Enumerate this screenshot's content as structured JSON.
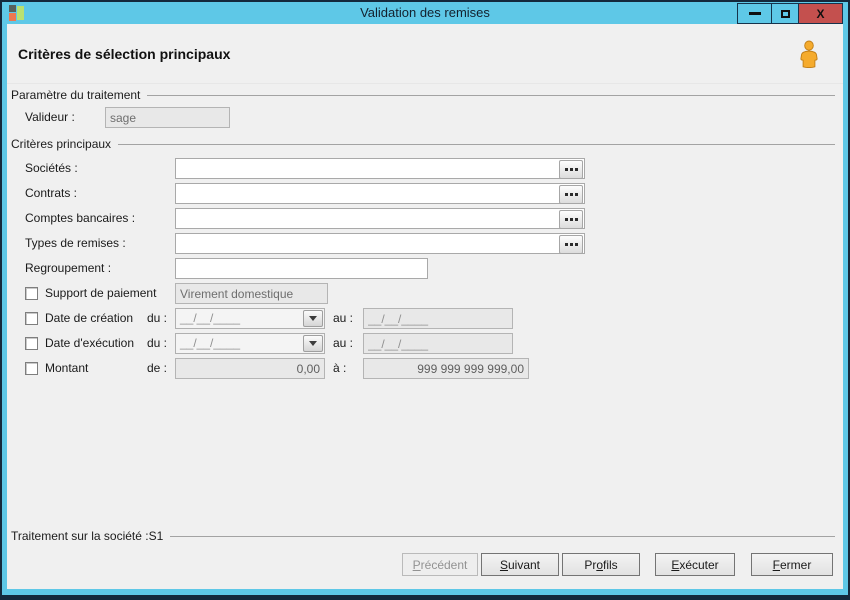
{
  "colors": {
    "titlebar": "#5ec8e7",
    "close_button": "#c4504e",
    "content_bg": "#f0f0f0",
    "user_icon_orange": "#f2a532"
  },
  "window": {
    "title": "Validation des remises",
    "controls": {
      "close_glyph": "X"
    }
  },
  "header": {
    "title": "Critères de sélection principaux"
  },
  "treatment_group": {
    "label": "Paramètre du traitement",
    "validator": {
      "label": "Valideur :",
      "value": "sage"
    }
  },
  "criteria_group": {
    "label": "Critères principaux",
    "lookup_rows": [
      {
        "label": "Sociétés :",
        "value": ""
      },
      {
        "label": "Contrats :",
        "value": ""
      },
      {
        "label": "Comptes bancaires :",
        "value": ""
      },
      {
        "label": "Types de remises :",
        "value": ""
      }
    ],
    "regroupement": {
      "label": "Regroupement :",
      "value": ""
    },
    "support": {
      "label": "Support de paiement",
      "checked": false,
      "value": "Virement domestique"
    },
    "date_creation": {
      "label": "Date de création",
      "checked": false,
      "from_label": "du :",
      "from_value": "__/__/____",
      "to_label": "au :",
      "to_value": "__/__/____"
    },
    "date_execution": {
      "label": "Date d'exécution",
      "checked": false,
      "from_label": "du :",
      "from_value": "__/__/____",
      "to_label": "au :",
      "to_value": "__/__/____"
    },
    "montant": {
      "label": "Montant",
      "checked": false,
      "from_label": "de :",
      "from_value": "0,00",
      "to_label": "à :",
      "to_value": "999 999 999 999,00"
    }
  },
  "footer": {
    "status": "Traitement sur la société :S1",
    "buttons": [
      {
        "label": "Précédent",
        "mnemonic": "P",
        "disabled": true
      },
      {
        "label": "Suivant",
        "mnemonic": "S",
        "disabled": false
      },
      {
        "label": "Profils",
        "mnemonic": "o",
        "disabled": false
      },
      {
        "label": "Exécuter",
        "mnemonic": "E",
        "disabled": false
      },
      {
        "label": "Fermer",
        "mnemonic": "F",
        "disabled": false
      }
    ]
  }
}
